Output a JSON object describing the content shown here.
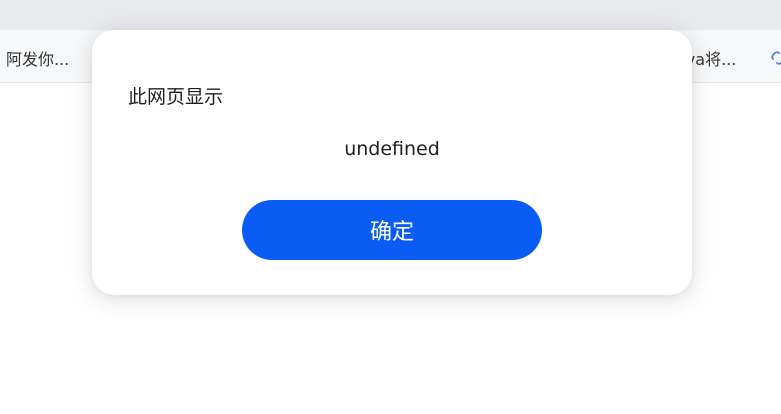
{
  "browser": {
    "bookmarks": [
      {
        "label": "阿发你..."
      },
      {
        "label": "ava将..."
      }
    ]
  },
  "dialog": {
    "title": "此网页显示",
    "message": "undefined",
    "ok_label": "确定"
  },
  "colors": {
    "accent": "#0b5cf5"
  }
}
